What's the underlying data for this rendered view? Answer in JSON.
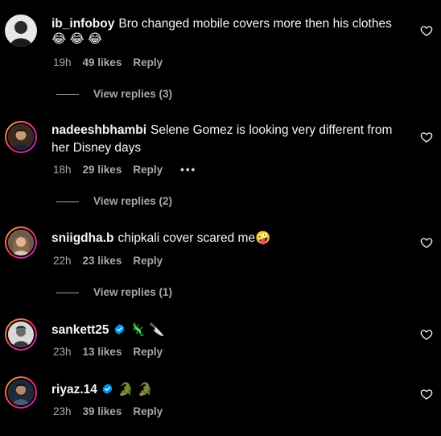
{
  "comments": [
    {
      "username": "ib_infoboy",
      "text": "Bro changed mobile covers more then his clothes",
      "emojis": [
        "😂",
        "😂",
        "😂"
      ],
      "time": "19h",
      "likes": "49 likes",
      "reply": "Reply",
      "view_replies": "View replies (3)",
      "verified": false
    },
    {
      "username": "nadeeshbhambi",
      "text": "Selene Gomez is looking very different from",
      "text_line2": "her Disney days",
      "time": "18h",
      "likes": "29 likes",
      "reply": "Reply",
      "more": "•••",
      "view_replies": "View replies (2)",
      "verified": false
    },
    {
      "username": "sniigdha.b",
      "text": "chipkali cover scared me",
      "emojis": [
        "🤪"
      ],
      "time": "22h",
      "likes": "23 likes",
      "reply": "Reply",
      "view_replies": "View replies (1)",
      "verified": false
    },
    {
      "username": "sankett25",
      "text": "",
      "emojis": [
        "🦎",
        "🔪"
      ],
      "time": "23h",
      "likes": "13 likes",
      "reply": "Reply",
      "verified": true
    },
    {
      "username": "riyaz.14",
      "text": "",
      "emojis": [
        "🐊",
        "🐊"
      ],
      "time": "23h",
      "likes": "39 likes",
      "reply": "Reply",
      "verified": true
    }
  ],
  "colors": {
    "background": "#000000",
    "text": "#f5f5f5",
    "secondary_text": "#a8a8a8",
    "verified_badge": "#0095f6"
  },
  "icons": {
    "like": "heart-outline-icon",
    "verified": "verified-badge-icon",
    "more": "more-options-icon"
  }
}
